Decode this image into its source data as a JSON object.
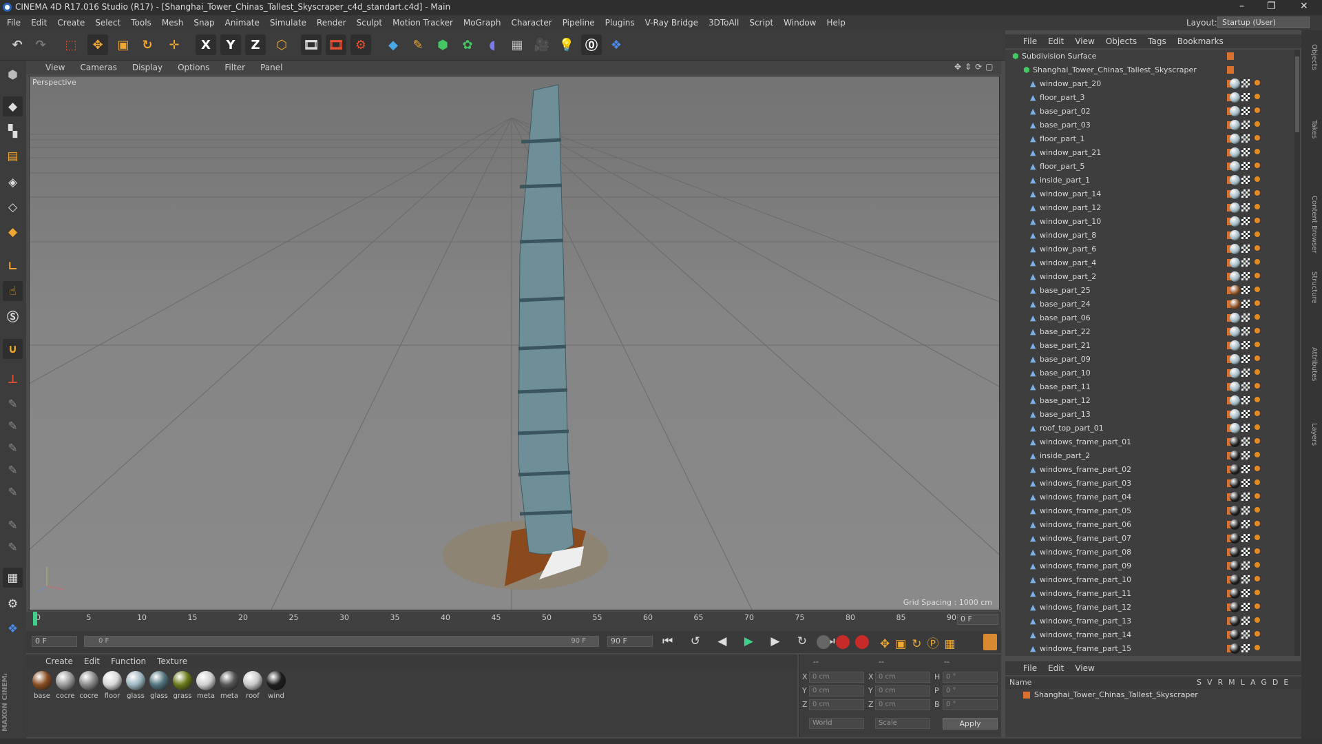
{
  "window": {
    "title": "CINEMA 4D R17.016 Studio (R17) - [Shanghai_Tower_Chinas_Tallest_Skyscraper_c4d_standart.c4d] - Main",
    "minimize": "–",
    "maximize": "❐",
    "close": "✕"
  },
  "menu": [
    "File",
    "Edit",
    "Create",
    "Select",
    "Tools",
    "Mesh",
    "Snap",
    "Animate",
    "Simulate",
    "Render",
    "Sculpt",
    "Motion Tracker",
    "MoGraph",
    "Character",
    "Pipeline",
    "Plugins",
    "V-Ray Bridge",
    "3DToAll",
    "Script",
    "Window",
    "Help"
  ],
  "layout": {
    "label": "Layout:",
    "value": "Startup (User)"
  },
  "toolbar": {
    "x": "X",
    "y": "Y",
    "z": "Z"
  },
  "viewport": {
    "menu": [
      "View",
      "Cameras",
      "Display",
      "Options",
      "Filter",
      "Panel"
    ],
    "label": "Perspective",
    "grid_spacing": "Grid Spacing : 1000 cm"
  },
  "timeline": {
    "ticks": [
      "0",
      "5",
      "10",
      "15",
      "20",
      "25",
      "30",
      "35",
      "40",
      "45",
      "50",
      "55",
      "60",
      "65",
      "70",
      "75",
      "80",
      "85",
      "90"
    ],
    "current_frame": "0 F",
    "start": "0 F",
    "range_start": "0 F",
    "range_end": "90 F",
    "end": "90 F"
  },
  "materials": {
    "menu": [
      "Create",
      "Edit",
      "Function",
      "Texture"
    ],
    "items": [
      {
        "name": "base",
        "color": "#8a4e22"
      },
      {
        "name": "cocre",
        "color": "#9a9a9a"
      },
      {
        "name": "cocre",
        "color": "#8c8c8c"
      },
      {
        "name": "floor",
        "color": "#d8d8d8"
      },
      {
        "name": "glass",
        "color": "#9fb7c2"
      },
      {
        "name": "glass",
        "color": "#52757f"
      },
      {
        "name": "grass",
        "color": "#6a7a1a"
      },
      {
        "name": "meta",
        "color": "#d0d0d0"
      },
      {
        "name": "meta",
        "color": "#555555"
      },
      {
        "name": "roof",
        "color": "#c9c9c9"
      },
      {
        "name": "wind",
        "color": "#1e1e1e"
      }
    ]
  },
  "coords": {
    "x_pos": "0 cm",
    "y_pos": "0 cm",
    "z_pos": "0 cm",
    "x_size": "0 cm",
    "y_size": "0 cm",
    "z_size": "0 cm",
    "h": "0 °",
    "p": "0 °",
    "b": "0 °",
    "mode": "World",
    "size_mode": "Scale",
    "apply": "Apply",
    "dash1": "--",
    "dash2": "--",
    "dash3": "--"
  },
  "objects": {
    "menu": [
      "File",
      "Edit",
      "View",
      "Objects",
      "Tags",
      "Bookmarks"
    ],
    "root": "Subdivision Surface",
    "group": "Shanghai_Tower_Chinas_Tallest_Skyscraper",
    "items": [
      "window_part_20",
      "floor_part_3",
      "base_part_02",
      "base_part_03",
      "floor_part_1",
      "window_part_21",
      "floor_part_5",
      "inside_part_1",
      "window_part_14",
      "window_part_12",
      "window_part_10",
      "window_part_8",
      "window_part_6",
      "window_part_4",
      "window_part_2",
      "base_part_25",
      "base_part_24",
      "base_part_06",
      "base_part_22",
      "base_part_21",
      "base_part_09",
      "base_part_10",
      "base_part_11",
      "base_part_12",
      "base_part_13",
      "roof_top_part_01",
      "windows_frame_part_01",
      "inside_part_2",
      "windows_frame_part_02",
      "windows_frame_part_03",
      "windows_frame_part_04",
      "windows_frame_part_05",
      "windows_frame_part_06",
      "windows_frame_part_07",
      "windows_frame_part_08",
      "windows_frame_part_09",
      "windows_frame_part_10",
      "windows_frame_part_11",
      "windows_frame_part_12",
      "windows_frame_part_13",
      "windows_frame_part_14",
      "windows_frame_part_15"
    ]
  },
  "layers": {
    "menu": [
      "File",
      "Edit",
      "View"
    ],
    "name_col": "Name",
    "cols": [
      "S",
      "V",
      "R",
      "M",
      "L",
      "A",
      "G",
      "D",
      "E"
    ],
    "row": "Shanghai_Tower_Chinas_Tallest_Skyscraper"
  },
  "side_tabs": [
    "Objects",
    "Takes",
    "Content Browser",
    "Structure",
    "Attributes",
    "Layers"
  ],
  "brand": "MAXON CINEMA 4D",
  "colors": {
    "accent": "#d9702e",
    "bg": "#3c3c3c",
    "viewport": "#808080"
  }
}
